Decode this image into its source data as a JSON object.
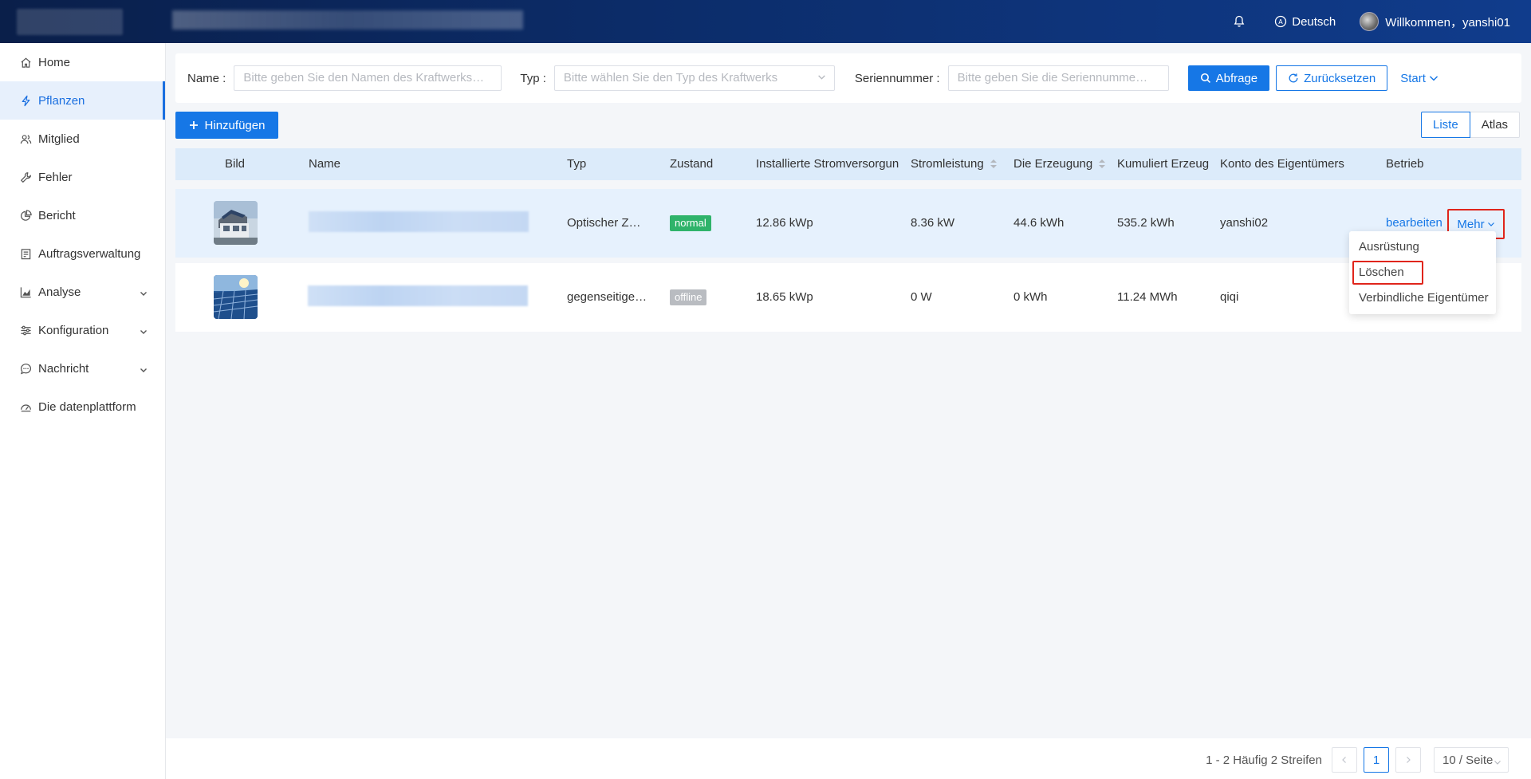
{
  "header": {
    "language": "Deutsch",
    "welcome": "Willkommen，yanshi01"
  },
  "sidebar": {
    "items": [
      {
        "label": "Home"
      },
      {
        "label": "Pflanzen"
      },
      {
        "label": "Mitglied"
      },
      {
        "label": "Fehler"
      },
      {
        "label": "Bericht"
      },
      {
        "label": "Auftragsverwaltung"
      },
      {
        "label": "Analyse"
      },
      {
        "label": "Konfiguration"
      },
      {
        "label": "Nachricht"
      },
      {
        "label": "Die datenplattform"
      }
    ]
  },
  "filter": {
    "name_label": "Name :",
    "name_placeholder": "Bitte geben Sie den Namen des Kraftwerks…",
    "type_label": "Typ :",
    "type_placeholder": "Bitte wählen Sie den Typ des Kraftwerks",
    "serial_label": "Seriennummer :",
    "serial_placeholder": "Bitte geben Sie die Seriennumme…",
    "query_button": "Abfrage",
    "reset_button": "Zurücksetzen",
    "start_link": "Start"
  },
  "toolbar": {
    "add_button": "Hinzufügen",
    "view_list": "Liste",
    "view_atlas": "Atlas"
  },
  "table": {
    "columns": [
      "Bild",
      "Name",
      "Typ",
      "Zustand",
      "Installierte Stromversorgun",
      "Stromleistung",
      "Die Erzeugung",
      "Kumuliert Erzeug",
      "Konto des Eigentümers",
      "Betrieb"
    ],
    "rows": [
      {
        "type": "Optischer Z…",
        "status": "normal",
        "capacity": "12.86 kWp",
        "power": "8.36 kW",
        "generation": "44.6 kWh",
        "cumulative": "535.2 kWh",
        "owner": "yanshi02",
        "edit": "bearbeiten",
        "more": "Mehr"
      },
      {
        "type": "gegenseitige…",
        "status": "offline",
        "capacity": "18.65 kWp",
        "power": "0 W",
        "generation": "0 kWh",
        "cumulative": "11.24 MWh",
        "owner": "qiqi"
      }
    ]
  },
  "more_menu": {
    "items": [
      "Ausrüstung",
      "Löschen",
      "Verbindliche Eigentümer"
    ]
  },
  "pagination": {
    "summary": "1 - 2 Häufig 2 Streifen",
    "current_page": "1",
    "page_size": "10 / Seite"
  }
}
